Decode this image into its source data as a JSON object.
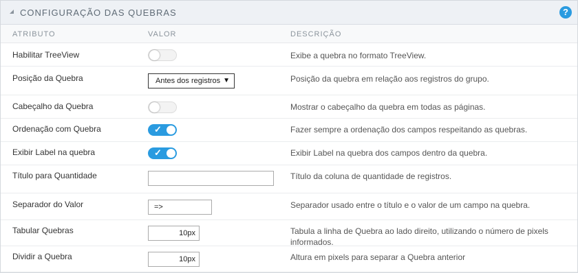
{
  "header": {
    "title": "CONFIGURAÇÃO DAS QUEBRAS",
    "help_label": "?"
  },
  "columns": {
    "attribute": "ATRIBUTO",
    "value": "VALOR",
    "description": "DESCRIÇÃO"
  },
  "rows": [
    {
      "label": "Habilitar TreeView",
      "control": "toggle",
      "checked": false,
      "description": "Exibe a quebra no formato TreeView."
    },
    {
      "label": "Posição da Quebra",
      "control": "select",
      "selected": "Antes dos registros",
      "description": "Posição da quebra em relação aos registros do grupo."
    },
    {
      "label": "Cabeçalho da Quebra",
      "control": "toggle",
      "checked": false,
      "description": "Mostrar o cabeçalho da quebra em todas as páginas."
    },
    {
      "label": "Ordenação com Quebra",
      "control": "toggle",
      "checked": true,
      "description": "Fazer sempre a ordenação dos campos respeitando as quebras."
    },
    {
      "label": "Exibir Label na quebra",
      "control": "toggle",
      "checked": true,
      "description": "Exibir Label na quebra dos campos dentro da quebra."
    },
    {
      "label": "Título para Quantidade",
      "control": "text",
      "value": "",
      "description": "Título da coluna de quantidade de registros."
    },
    {
      "label": "Separador do Valor",
      "control": "text",
      "value": "=>",
      "description": "Separador usado entre o título e o valor de um campo na quebra."
    },
    {
      "label": "Tabular Quebras",
      "control": "number",
      "value": "10px",
      "description": "Tabula a linha de Quebra ao lado direito, utilizando o número de pixels informados."
    },
    {
      "label": "Dividir a Quebra",
      "control": "number",
      "value": "10px",
      "description": "Altura em pixels para separar a Quebra anterior"
    }
  ],
  "icons": {
    "collapse": "triangle-collapse-icon",
    "check": "check-icon",
    "dropdown": "dropdown-arrow-icon"
  },
  "colors": {
    "accent": "#2a9be0",
    "header_bg": "#eef1f5"
  }
}
